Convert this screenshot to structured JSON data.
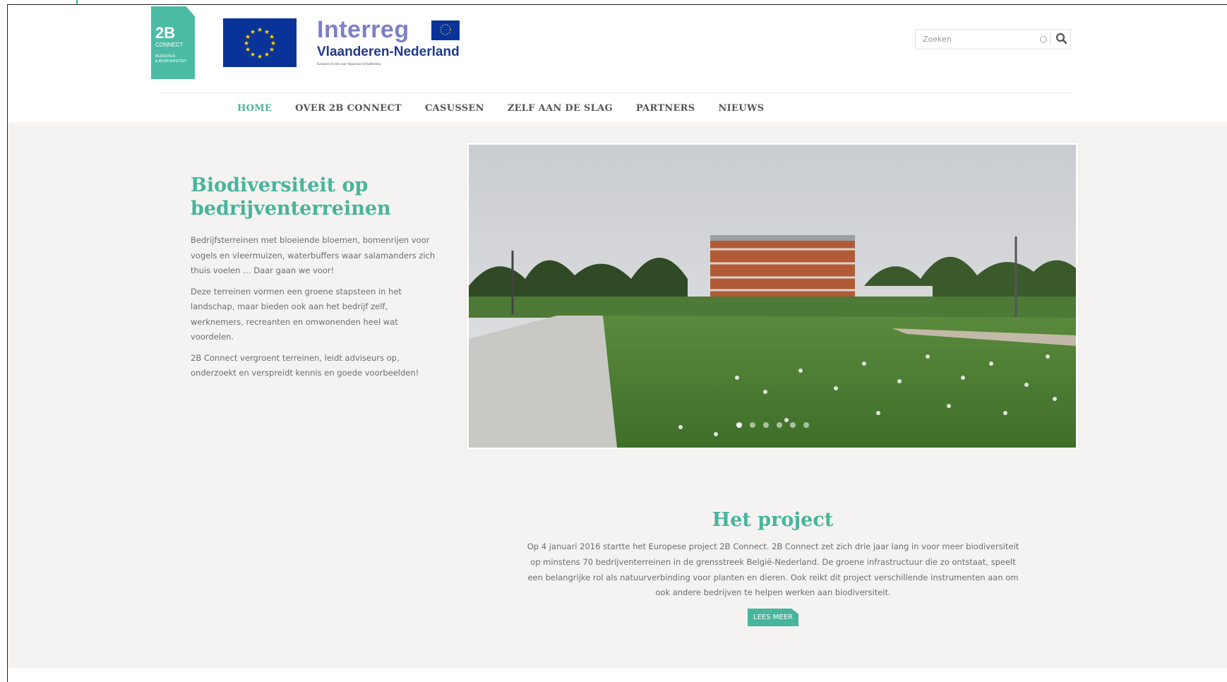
{
  "brand": {
    "logo_big": "2B",
    "logo_connect": "CONNECT",
    "logo_small_1": "BEDRIJVEN",
    "logo_small_2": "& BIODIVERSITEIT",
    "interreg_name": "Interreg",
    "interreg_region": "Vlaanderen-Nederland",
    "interreg_fund": "Europees Fonds voor Regionale Ontwikkeling",
    "eu_label": "EUROPESE UNIE"
  },
  "search": {
    "placeholder": "Zoeken"
  },
  "nav": {
    "items": [
      {
        "label": "HOME"
      },
      {
        "label": "OVER 2B CONNECT"
      },
      {
        "label": "CASUSSEN"
      },
      {
        "label": "ZELF AAN DE SLAG"
      },
      {
        "label": "PARTNERS"
      },
      {
        "label": "NIEUWS"
      }
    ]
  },
  "hero": {
    "title": "Biodiversiteit op bedrijventerreinen",
    "paragraphs": [
      "Bedrijfsterreinen met bloeiende bloemen, bomenrijen voor vogels en vleermuizen, waterbuffers waar salamanders zich thuis voelen … Daar gaan we voor!",
      "Deze terreinen vormen een groene stapsteen in het landschap, maar bieden ook aan het bedrijf zelf, werknemers, recreanten en omwonenden heel wat voordelen.",
      "2B Connect vergroent terreinen, leidt adviseurs op, onderzoekt en verspreidt kennis en goede voorbeelden!"
    ]
  },
  "slider": {
    "slide_count": 6,
    "active_index": 0
  },
  "project": {
    "title": "Het project",
    "text": "Op 4 januari 2016 startte het Europese project 2B Connect. 2B Connect zet zich drie jaar lang in voor meer biodiversiteit op minstens 70 bedrijventerreinen in de grensstreek België-Nederland. De groene infrastructuur die zo ontstaat, speelt een belangrijke rol als natuurverbinding voor planten en dieren. Ook reikt dit project verschillende instrumenten aan om ook andere bedrijven te helpen werken aan biodiversiteit.",
    "button_label": "LEES MEER"
  },
  "colors": {
    "accent": "#46b59b",
    "eu_blue": "#0a3399",
    "interreg_purple": "#7c80c6"
  }
}
